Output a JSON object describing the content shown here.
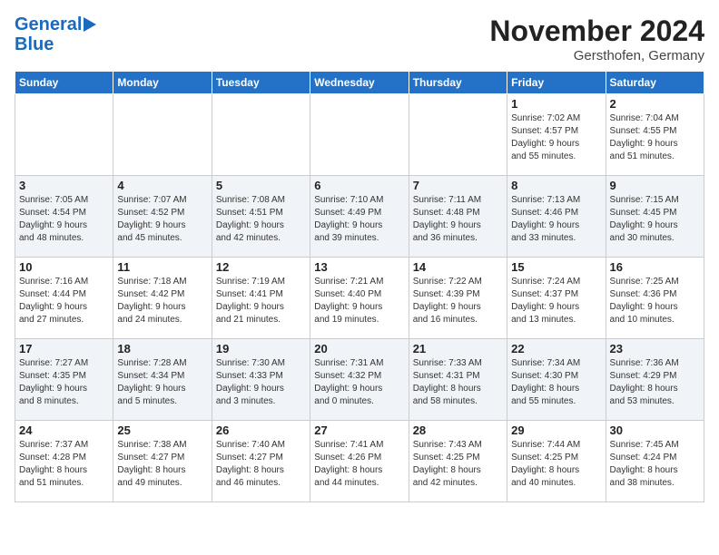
{
  "header": {
    "logo_line1": "General",
    "logo_line2": "Blue",
    "month": "November 2024",
    "location": "Gersthofen, Germany"
  },
  "weekdays": [
    "Sunday",
    "Monday",
    "Tuesday",
    "Wednesday",
    "Thursday",
    "Friday",
    "Saturday"
  ],
  "weeks": [
    [
      {
        "day": "",
        "info": ""
      },
      {
        "day": "",
        "info": ""
      },
      {
        "day": "",
        "info": ""
      },
      {
        "day": "",
        "info": ""
      },
      {
        "day": "",
        "info": ""
      },
      {
        "day": "1",
        "info": "Sunrise: 7:02 AM\nSunset: 4:57 PM\nDaylight: 9 hours\nand 55 minutes."
      },
      {
        "day": "2",
        "info": "Sunrise: 7:04 AM\nSunset: 4:55 PM\nDaylight: 9 hours\nand 51 minutes."
      }
    ],
    [
      {
        "day": "3",
        "info": "Sunrise: 7:05 AM\nSunset: 4:54 PM\nDaylight: 9 hours\nand 48 minutes."
      },
      {
        "day": "4",
        "info": "Sunrise: 7:07 AM\nSunset: 4:52 PM\nDaylight: 9 hours\nand 45 minutes."
      },
      {
        "day": "5",
        "info": "Sunrise: 7:08 AM\nSunset: 4:51 PM\nDaylight: 9 hours\nand 42 minutes."
      },
      {
        "day": "6",
        "info": "Sunrise: 7:10 AM\nSunset: 4:49 PM\nDaylight: 9 hours\nand 39 minutes."
      },
      {
        "day": "7",
        "info": "Sunrise: 7:11 AM\nSunset: 4:48 PM\nDaylight: 9 hours\nand 36 minutes."
      },
      {
        "day": "8",
        "info": "Sunrise: 7:13 AM\nSunset: 4:46 PM\nDaylight: 9 hours\nand 33 minutes."
      },
      {
        "day": "9",
        "info": "Sunrise: 7:15 AM\nSunset: 4:45 PM\nDaylight: 9 hours\nand 30 minutes."
      }
    ],
    [
      {
        "day": "10",
        "info": "Sunrise: 7:16 AM\nSunset: 4:44 PM\nDaylight: 9 hours\nand 27 minutes."
      },
      {
        "day": "11",
        "info": "Sunrise: 7:18 AM\nSunset: 4:42 PM\nDaylight: 9 hours\nand 24 minutes."
      },
      {
        "day": "12",
        "info": "Sunrise: 7:19 AM\nSunset: 4:41 PM\nDaylight: 9 hours\nand 21 minutes."
      },
      {
        "day": "13",
        "info": "Sunrise: 7:21 AM\nSunset: 4:40 PM\nDaylight: 9 hours\nand 19 minutes."
      },
      {
        "day": "14",
        "info": "Sunrise: 7:22 AM\nSunset: 4:39 PM\nDaylight: 9 hours\nand 16 minutes."
      },
      {
        "day": "15",
        "info": "Sunrise: 7:24 AM\nSunset: 4:37 PM\nDaylight: 9 hours\nand 13 minutes."
      },
      {
        "day": "16",
        "info": "Sunrise: 7:25 AM\nSunset: 4:36 PM\nDaylight: 9 hours\nand 10 minutes."
      }
    ],
    [
      {
        "day": "17",
        "info": "Sunrise: 7:27 AM\nSunset: 4:35 PM\nDaylight: 9 hours\nand 8 minutes."
      },
      {
        "day": "18",
        "info": "Sunrise: 7:28 AM\nSunset: 4:34 PM\nDaylight: 9 hours\nand 5 minutes."
      },
      {
        "day": "19",
        "info": "Sunrise: 7:30 AM\nSunset: 4:33 PM\nDaylight: 9 hours\nand 3 minutes."
      },
      {
        "day": "20",
        "info": "Sunrise: 7:31 AM\nSunset: 4:32 PM\nDaylight: 9 hours\nand 0 minutes."
      },
      {
        "day": "21",
        "info": "Sunrise: 7:33 AM\nSunset: 4:31 PM\nDaylight: 8 hours\nand 58 minutes."
      },
      {
        "day": "22",
        "info": "Sunrise: 7:34 AM\nSunset: 4:30 PM\nDaylight: 8 hours\nand 55 minutes."
      },
      {
        "day": "23",
        "info": "Sunrise: 7:36 AM\nSunset: 4:29 PM\nDaylight: 8 hours\nand 53 minutes."
      }
    ],
    [
      {
        "day": "24",
        "info": "Sunrise: 7:37 AM\nSunset: 4:28 PM\nDaylight: 8 hours\nand 51 minutes."
      },
      {
        "day": "25",
        "info": "Sunrise: 7:38 AM\nSunset: 4:27 PM\nDaylight: 8 hours\nand 49 minutes."
      },
      {
        "day": "26",
        "info": "Sunrise: 7:40 AM\nSunset: 4:27 PM\nDaylight: 8 hours\nand 46 minutes."
      },
      {
        "day": "27",
        "info": "Sunrise: 7:41 AM\nSunset: 4:26 PM\nDaylight: 8 hours\nand 44 minutes."
      },
      {
        "day": "28",
        "info": "Sunrise: 7:43 AM\nSunset: 4:25 PM\nDaylight: 8 hours\nand 42 minutes."
      },
      {
        "day": "29",
        "info": "Sunrise: 7:44 AM\nSunset: 4:25 PM\nDaylight: 8 hours\nand 40 minutes."
      },
      {
        "day": "30",
        "info": "Sunrise: 7:45 AM\nSunset: 4:24 PM\nDaylight: 8 hours\nand 38 minutes."
      }
    ]
  ]
}
